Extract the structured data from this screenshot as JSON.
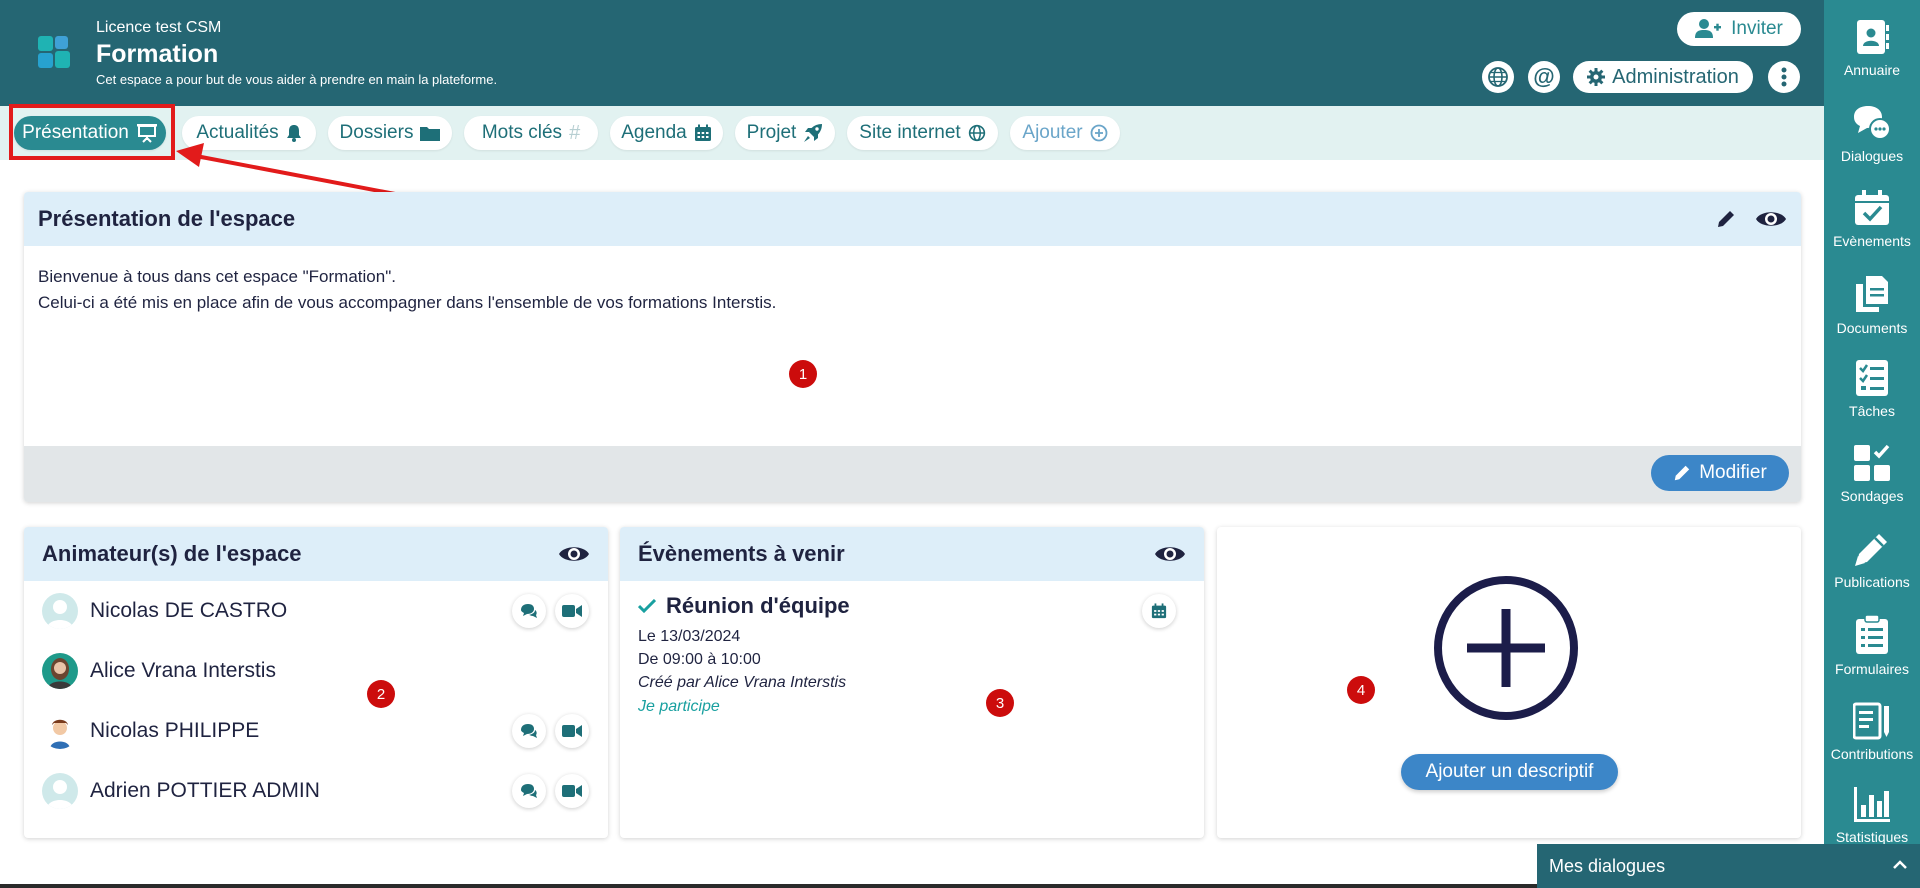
{
  "header": {
    "licence": "Licence test CSM",
    "title": "Formation",
    "description": "Cet espace a pour but de vous aider à prendre en main la plateforme.",
    "invite_label": "Inviter",
    "admin_label": "Administration"
  },
  "tabs": [
    {
      "label": "Présentation",
      "icon": "presentation-icon",
      "active": true
    },
    {
      "label": "Actualités",
      "icon": "bell-icon"
    },
    {
      "label": "Dossiers",
      "icon": "folder-icon"
    },
    {
      "label": "Mots clés",
      "icon": "hashtag-icon"
    },
    {
      "label": "Agenda",
      "icon": "calendar-icon"
    },
    {
      "label": "Projet",
      "icon": "rocket-icon"
    },
    {
      "label": "Site internet",
      "icon": "globe-icon"
    },
    {
      "label": "Ajouter",
      "icon": "plus-circle-icon"
    }
  ],
  "presentation": {
    "title": "Présentation de l'espace",
    "text_line1": "Bienvenue à tous dans cet espace \"Formation\".",
    "text_line2": "Celui-ci a été mis en place afin de vous accompagner dans l'ensemble de vos formations Interstis.",
    "modify_label": "Modifier",
    "badge": "1"
  },
  "animators": {
    "title": "Animateur(s) de l'espace",
    "badge": "2",
    "members": [
      {
        "name": "Nicolas DE CASTRO",
        "actions": true
      },
      {
        "name": "Alice Vrana Interstis",
        "actions": false
      },
      {
        "name": "Nicolas PHILIPPE",
        "actions": true
      },
      {
        "name": "Adrien POTTIER ADMIN",
        "actions": true
      }
    ]
  },
  "events": {
    "title": "Évènements à venir",
    "badge": "3",
    "event_title": "Réunion d'équipe",
    "date": "Le 13/03/2024",
    "time": "De 09:00 à 10:00",
    "created_by": "Créé par Alice Vrana Interstis",
    "participate": "Je participe"
  },
  "descriptif": {
    "badge": "4",
    "button_label": "Ajouter un descriptif"
  },
  "sidebar": {
    "items": [
      {
        "label": "Annuaire",
        "icon": "address-book-icon"
      },
      {
        "label": "Dialogues",
        "icon": "chat-bubbles-icon"
      },
      {
        "label": "Evènements",
        "icon": "calendar-check-icon"
      },
      {
        "label": "Documents",
        "icon": "documents-icon"
      },
      {
        "label": "Tâches",
        "icon": "task-list-icon"
      },
      {
        "label": "Sondages",
        "icon": "poll-icon"
      },
      {
        "label": "Publications",
        "icon": "pen-icon"
      },
      {
        "label": "Formulaires",
        "icon": "form-icon"
      },
      {
        "label": "Contributions",
        "icon": "contributions-icon"
      },
      {
        "label": "Statistiques",
        "icon": "chart-icon"
      }
    ]
  },
  "dialogs_bar": {
    "label": "Mes dialogues"
  },
  "colors": {
    "header": "#256673",
    "sidebar": "#2a8a91",
    "accent": "#2a8a91",
    "button_blue": "#3c86c8",
    "highlight_red": "#e21b1b",
    "badge_red": "#cc0c0c"
  }
}
